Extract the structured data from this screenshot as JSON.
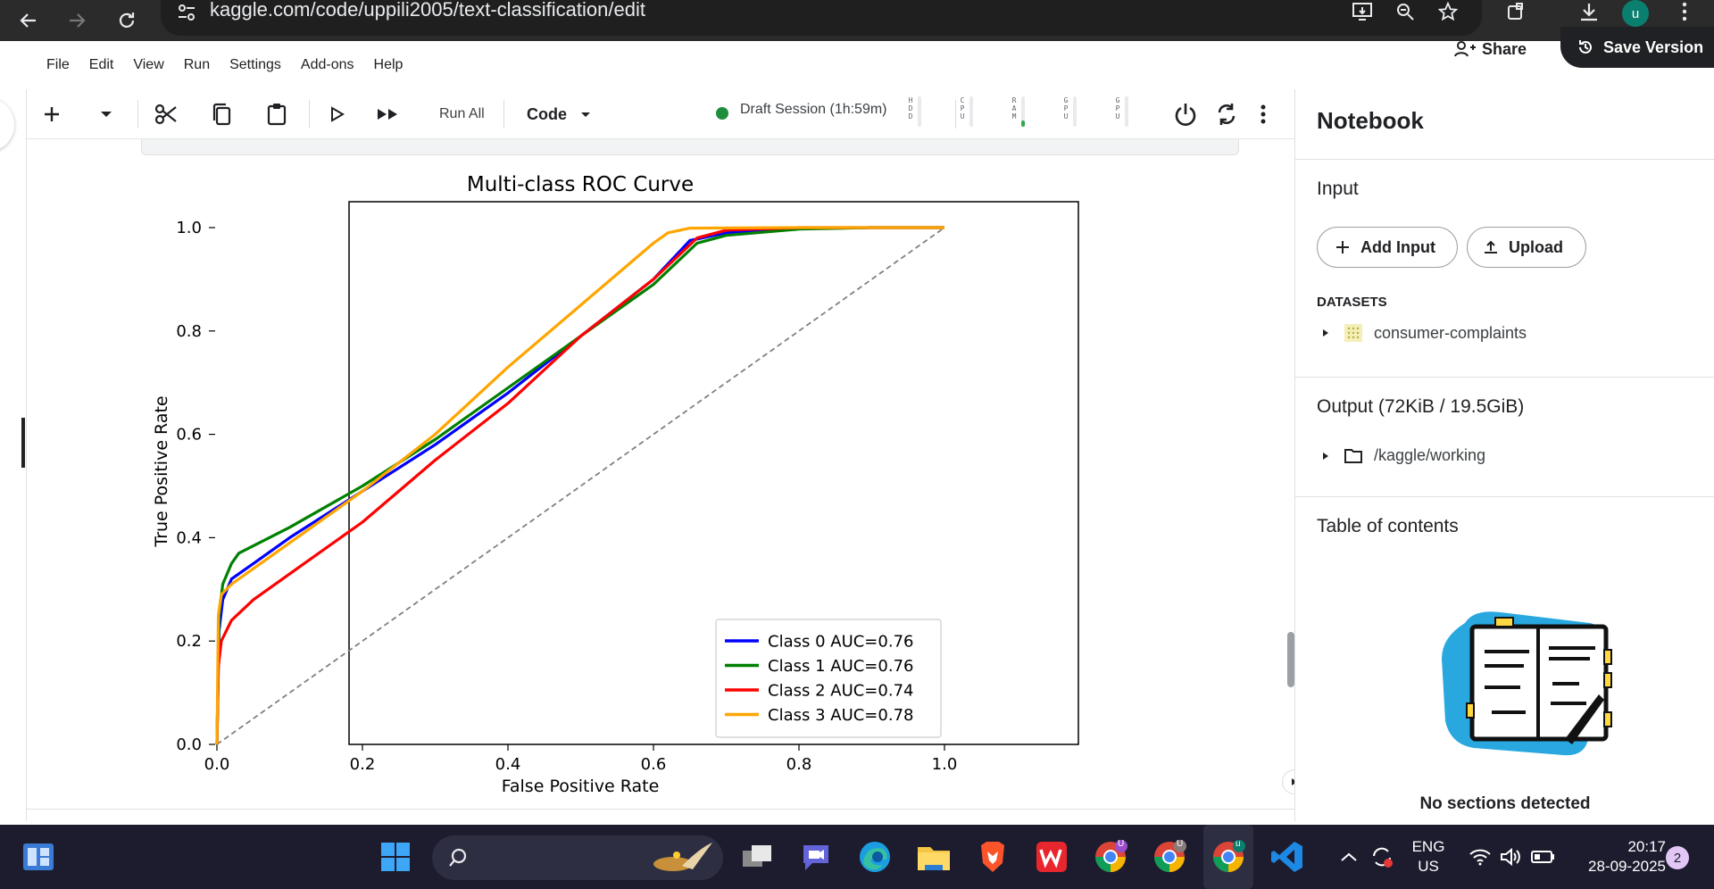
{
  "browser": {
    "url": "kaggle.com/code/uppili2005/text-classification/edit",
    "avatar_letter": "u"
  },
  "menu": {
    "items": [
      "File",
      "Edit",
      "View",
      "Run",
      "Settings",
      "Add-ons",
      "Help"
    ],
    "share_label": "Share",
    "save_version_label": "Save Version"
  },
  "toolbar": {
    "run_all_label": "Run All",
    "cell_type": "Code",
    "session_status": "Draft Session (1h:59m)",
    "meters": [
      {
        "label": "HDD",
        "level": 0.0
      },
      {
        "label": "CPU",
        "level": 0.0
      },
      {
        "label": "RAM",
        "level": 0.2
      },
      {
        "label": "GPU",
        "level": 0.0
      },
      {
        "label": "GPU",
        "level": 0.0
      }
    ],
    "accent_color": "#1e8e3e"
  },
  "chart_data": {
    "type": "line",
    "title": "Multi-class ROC Curve",
    "xlabel": "False Positive Rate",
    "ylabel": "True Positive Rate",
    "xlim": [
      0.0,
      1.0
    ],
    "ylim": [
      0.0,
      1.0
    ],
    "xticks": [
      "0.0",
      "0.2",
      "0.4",
      "0.6",
      "0.8",
      "1.0"
    ],
    "yticks": [
      "0.0",
      "0.2",
      "0.4",
      "0.6",
      "0.8",
      "1.0"
    ],
    "grid": false,
    "legend_position": "lower-right",
    "series": [
      {
        "name": "Class 0 AUC=0.76",
        "color": "#0000ff",
        "x": [
          0,
          0.003,
          0.008,
          0.02,
          0.05,
          0.1,
          0.2,
          0.3,
          0.4,
          0.5,
          0.6,
          0.65,
          0.7,
          0.8,
          0.9,
          1.0
        ],
        "y": [
          0,
          0.22,
          0.28,
          0.32,
          0.35,
          0.4,
          0.49,
          0.58,
          0.68,
          0.79,
          0.9,
          0.975,
          0.99,
          0.998,
          1.0,
          1.0
        ]
      },
      {
        "name": "Class 1 AUC=0.76",
        "color": "#008000",
        "x": [
          0,
          0.003,
          0.008,
          0.02,
          0.03,
          0.1,
          0.2,
          0.3,
          0.4,
          0.5,
          0.6,
          0.66,
          0.7,
          0.8,
          0.9,
          1.0
        ],
        "y": [
          0,
          0.25,
          0.31,
          0.35,
          0.37,
          0.42,
          0.5,
          0.59,
          0.69,
          0.79,
          0.89,
          0.97,
          0.985,
          0.997,
          1.0,
          1.0
        ]
      },
      {
        "name": "Class 2 AUC=0.74",
        "color": "#ff0000",
        "x": [
          0,
          0.002,
          0.006,
          0.02,
          0.05,
          0.1,
          0.2,
          0.3,
          0.4,
          0.5,
          0.6,
          0.66,
          0.7,
          0.8,
          0.9,
          1.0
        ],
        "y": [
          0,
          0.15,
          0.2,
          0.24,
          0.28,
          0.33,
          0.43,
          0.55,
          0.66,
          0.79,
          0.9,
          0.98,
          0.995,
          1.0,
          1.0,
          1.0
        ]
      },
      {
        "name": "Class 3 AUC=0.78",
        "color": "#ffa500",
        "x": [
          0,
          0.002,
          0.006,
          0.02,
          0.05,
          0.1,
          0.2,
          0.3,
          0.4,
          0.5,
          0.6,
          0.62,
          0.65,
          0.8,
          0.9,
          1.0
        ],
        "y": [
          0,
          0.25,
          0.29,
          0.31,
          0.34,
          0.39,
          0.49,
          0.6,
          0.73,
          0.85,
          0.97,
          0.99,
          0.999,
          1.0,
          1.0,
          1.0
        ]
      }
    ],
    "reference_line": {
      "x": [
        0,
        1
      ],
      "y": [
        0,
        1
      ],
      "color": "#808080",
      "style": "dashed"
    }
  },
  "right_panel": {
    "title": "Notebook",
    "input_heading": "Input",
    "add_input_label": "Add Input",
    "upload_label": "Upload",
    "datasets_heading": "DATASETS",
    "dataset_name": "consumer-complaints",
    "output_heading": "Output (72KiB / 19.5GiB)",
    "output_path": "/kaggle/working",
    "toc_heading": "Table of contents",
    "toc_empty": "No sections detected",
    "illustration_color": "#29a8e0"
  },
  "taskbar": {
    "search_label": "Search",
    "language_line1": "ENG",
    "language_line2": "US",
    "time": "20:17",
    "date": "28-09-2025",
    "notification_count": "2",
    "chrome_profile_letters": [
      "U",
      "U",
      "u"
    ]
  }
}
